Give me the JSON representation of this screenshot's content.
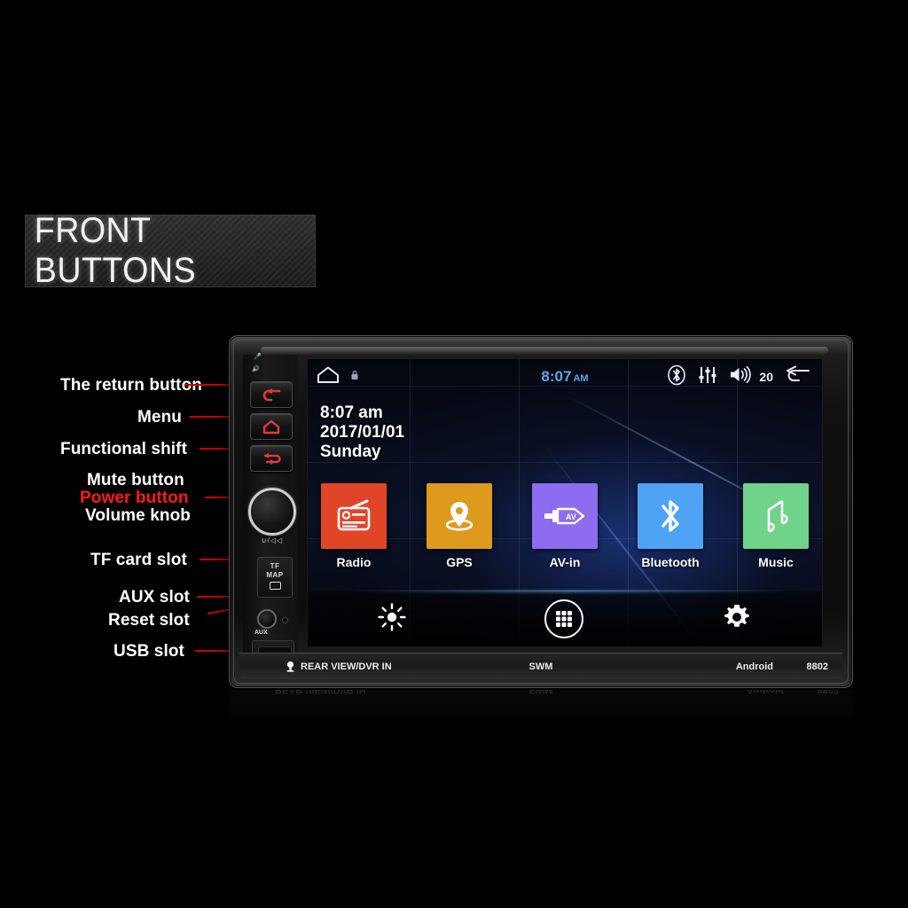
{
  "banner": {
    "title": "FRONT BUTTONS"
  },
  "callouts": [
    {
      "label": "The return button",
      "color": "#ffffff"
    },
    {
      "label": "Menu",
      "color": "#ffffff"
    },
    {
      "label": "Functional shift",
      "color": "#ffffff"
    },
    {
      "label": "Mute button",
      "color": "#ffffff"
    },
    {
      "label": "Power button",
      "color": "#ff1a1a"
    },
    {
      "label": "Volume knob",
      "color": "#ffffff"
    },
    {
      "label": "TF card slot",
      "color": "#ffffff"
    },
    {
      "label": "AUX slot",
      "color": "#ffffff"
    },
    {
      "label": "Reset slot",
      "color": "#ffffff"
    },
    {
      "label": "USB slot",
      "color": "#ffffff"
    }
  ],
  "device": {
    "controls": {
      "tf_slot_line1": "TF",
      "tf_slot_line2": "MAP",
      "aux_label": "AUX",
      "knob_marking": "∪/◁◁"
    },
    "bottom_plate": {
      "rear_view": "REAR VIEW/DVR IN",
      "swm": "SWM",
      "android": "Android",
      "model": "8802"
    }
  },
  "screen": {
    "statusbar": {
      "home_icon": "home-icon",
      "lock_icon": "lock-icon",
      "clock_time": "8:07",
      "clock_ampm": "AM",
      "bluetooth_icon": "bluetooth-icon",
      "equalizer_icon": "equalizer-icon",
      "volume_icon": "volume-icon",
      "volume_level": "20",
      "back_icon": "back-arrow-icon"
    },
    "clock_widget": {
      "time": "8:07 am",
      "date": "2017/01/01",
      "weekday": "Sunday"
    },
    "tiles": [
      {
        "label": "Radio",
        "icon": "radio-icon",
        "color": "#e14528"
      },
      {
        "label": "GPS",
        "icon": "location-pin-icon",
        "color": "#dd9a1c"
      },
      {
        "label": "AV-in",
        "icon": "av-plug-icon",
        "color": "#8d6cf0"
      },
      {
        "label": "Bluetooth",
        "icon": "bluetooth-icon",
        "color": "#4ea3f5"
      },
      {
        "label": "Music",
        "icon": "music-note-icon",
        "color": "#6fd38a"
      }
    ],
    "dock": [
      {
        "name": "brightness-icon",
        "label": "Brightness"
      },
      {
        "name": "app-drawer-icon",
        "label": "Apps"
      },
      {
        "name": "settings-gear-icon",
        "label": "Settings"
      }
    ]
  }
}
